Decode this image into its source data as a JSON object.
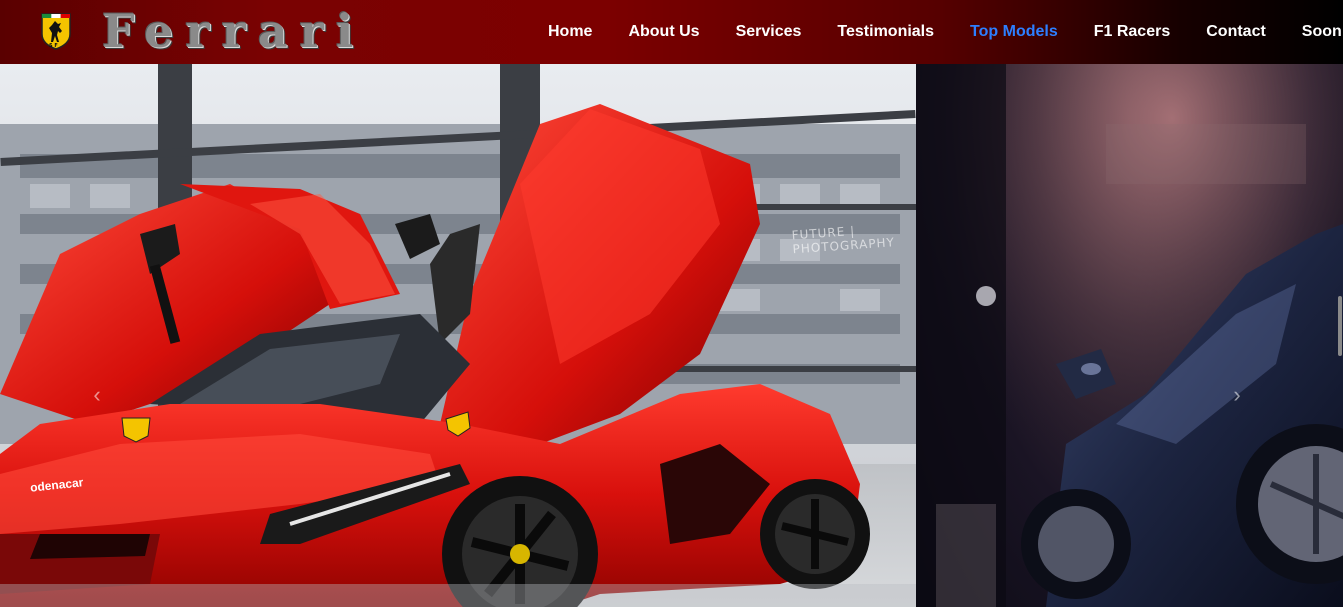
{
  "brand": {
    "name": "Ferrari",
    "logo_icon": "prancing-horse-shield-icon",
    "accent": "#7c0000"
  },
  "nav": {
    "items": [
      {
        "label": "Home"
      },
      {
        "label": "About Us"
      },
      {
        "label": "Services"
      },
      {
        "label": "Testimonials"
      },
      {
        "label": "Top Models"
      },
      {
        "label": "F1 Racers"
      },
      {
        "label": "Contact"
      },
      {
        "label": "Soon"
      }
    ],
    "active_color": "#2d7fff"
  },
  "carousel": {
    "prev_icon": "chevron-left-icon",
    "next_icon": "chevron-right-icon",
    "slide_1": {
      "watermark": "FUTURE | PHOTOGRAPHY",
      "plate": "odenacar"
    }
  }
}
